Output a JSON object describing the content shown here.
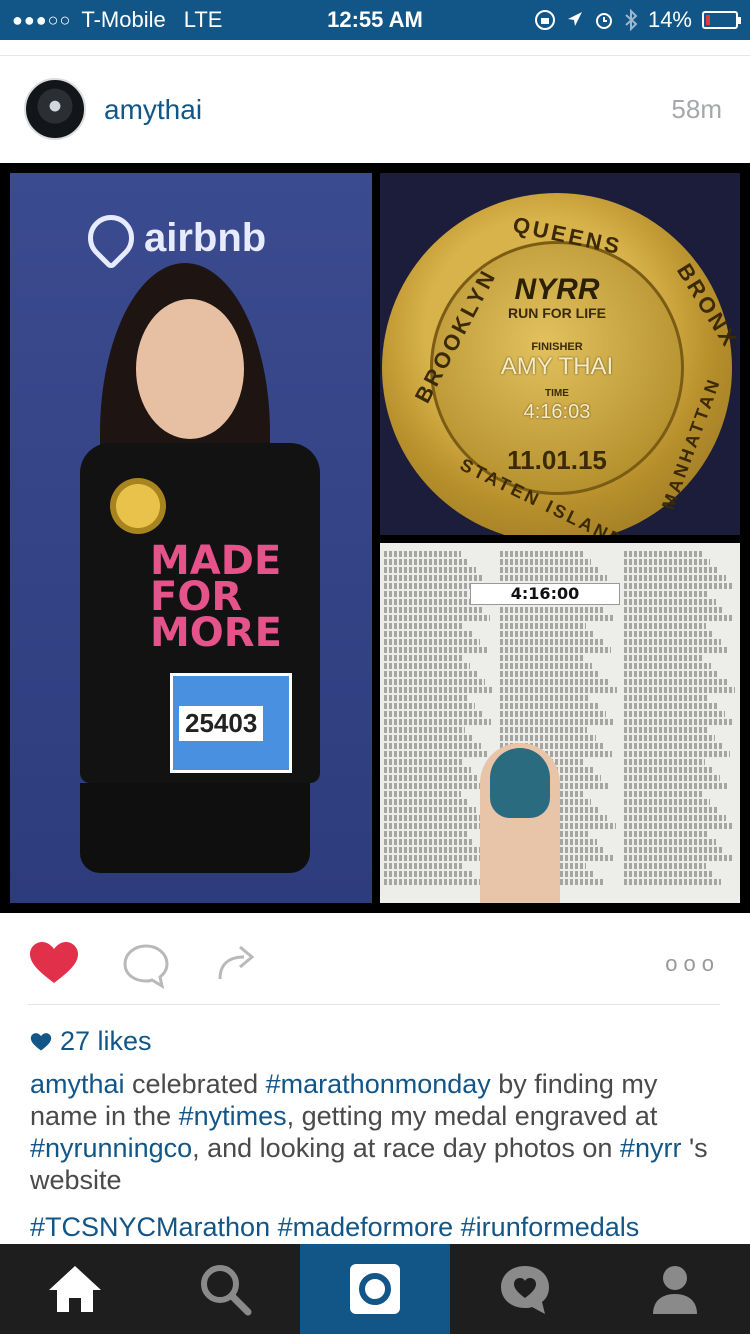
{
  "status_bar": {
    "signal": "●●●○○",
    "carrier": "T-Mobile",
    "network": "LTE",
    "time": "12:55 AM",
    "battery": "14%",
    "battery_level": 0.14
  },
  "post": {
    "username": "amythai",
    "age": "58m"
  },
  "photo": {
    "sponsor_logo": "airbnb",
    "shirt_text": [
      "MADE",
      "FOR",
      "MORE"
    ],
    "bib_number": "25403",
    "medal": {
      "top_text": "QUEENS",
      "left_text": "BROOKLYN",
      "right_text": "BRONX",
      "lower_right_text": "MANHATTAN",
      "bottom_text": "STATEN ISLAND",
      "logo": "NYRR",
      "subtitle": "RUN FOR LIFE",
      "finisher_label": "FINISHER",
      "finisher_name": "AMY THAI",
      "time_label": "TIME",
      "time": "4:16:03",
      "date": "11.01.15"
    },
    "newspaper_time": "4:16:00"
  },
  "actions": {
    "like": "heart-icon",
    "comment": "comment-icon",
    "share": "share-icon",
    "more": "ooo",
    "liked_color": "#e0304a"
  },
  "likes": "27 likes",
  "caption": {
    "user": "amythai",
    "t1": " celebrated ",
    "h1": "#marathonmonday",
    "t2": " by finding my name in the ",
    "h2": "#nytimes",
    "t3": ", getting my medal engraved at ",
    "h3": "#nyrunningco",
    "t4": ", and looking at race day photos on ",
    "h4": "#nyrr",
    "t5": " 's website",
    "tags_line": "#TCSNYCMarathon #madeformore #irunformedals"
  },
  "tab_bar": {
    "items": [
      "home-icon",
      "search-icon",
      "camera-icon",
      "activity-icon",
      "profile-icon"
    ],
    "active": "camera-icon"
  }
}
